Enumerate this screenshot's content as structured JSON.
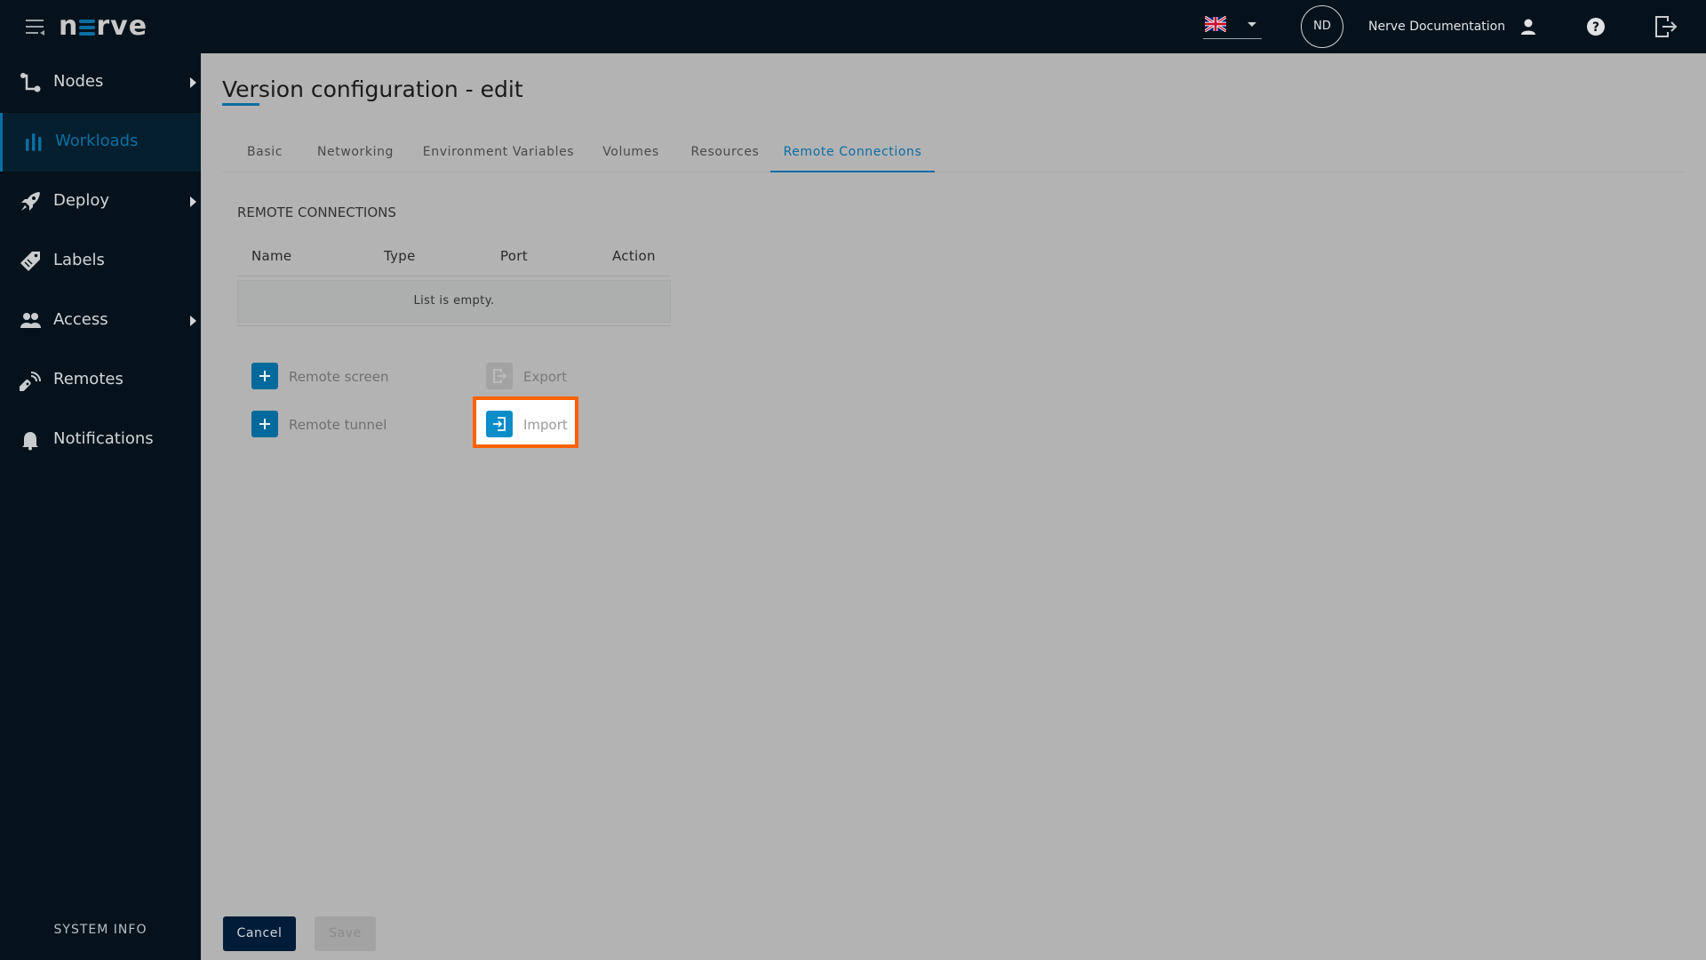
{
  "header": {
    "logo_text": "n≡rve",
    "logo_parts": {
      "left": "n",
      "right": "rve"
    },
    "language": {
      "selected": "English (UK)",
      "icon": "uk-flag-icon"
    },
    "avatar_initials": "ND",
    "user_name": "Nerve Documentation",
    "icons": [
      "menu-icon",
      "user-icon",
      "help-icon",
      "logout-icon"
    ]
  },
  "sidebar": {
    "items": [
      {
        "label": "Nodes",
        "icon": "nodes-icon",
        "has_submenu": true,
        "active": false
      },
      {
        "label": "Workloads",
        "icon": "workloads-icon",
        "has_submenu": false,
        "active": true
      },
      {
        "label": "Deploy",
        "icon": "rocket-icon",
        "has_submenu": true,
        "active": false
      },
      {
        "label": "Labels",
        "icon": "label-tag-icon",
        "has_submenu": false,
        "active": false
      },
      {
        "label": "Access",
        "icon": "users-icon",
        "has_submenu": true,
        "active": false
      },
      {
        "label": "Remotes",
        "icon": "remote-control-icon",
        "has_submenu": false,
        "active": false
      },
      {
        "label": "Notifications",
        "icon": "bell-icon",
        "has_submenu": false,
        "active": false
      }
    ],
    "system_info": "SYSTEM INFO"
  },
  "main": {
    "title": "Version configuration - edit",
    "tabs": [
      {
        "label": "Basic",
        "active": false
      },
      {
        "label": "Networking",
        "active": false
      },
      {
        "label": "Environment Variables",
        "active": false
      },
      {
        "label": "Volumes",
        "active": false
      },
      {
        "label": "Resources",
        "active": false
      },
      {
        "label": "Remote Connections",
        "active": true
      }
    ],
    "section_heading": "REMOTE CONNECTIONS",
    "table": {
      "columns": [
        "Name",
        "Type",
        "Port",
        "Action"
      ],
      "rows": [],
      "empty_message": "List is empty."
    },
    "actions": {
      "remote_screen": "Remote screen",
      "remote_tunnel": "Remote tunnel",
      "export": "Export",
      "import": "Import"
    },
    "highlighted_action": "Import",
    "footer": {
      "cancel": "Cancel",
      "save": "Save"
    }
  },
  "colors": {
    "accent": "#0a6ea2",
    "header_bg": "#06121b",
    "highlight": "#ff6200",
    "overlay_bg": "#b3b3b3"
  }
}
